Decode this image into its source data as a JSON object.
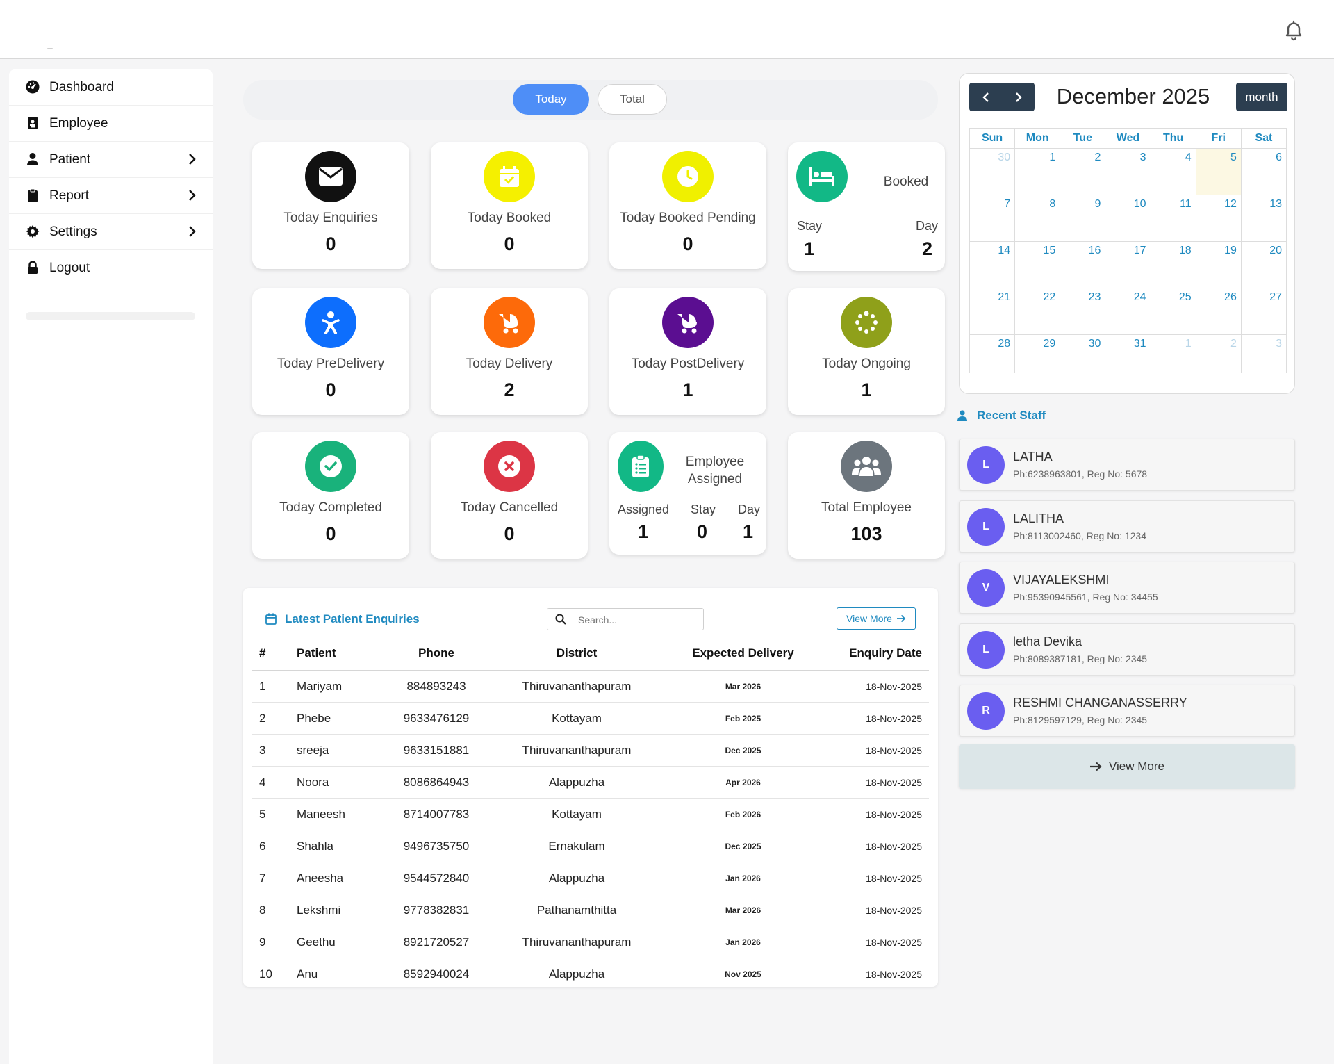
{
  "header": {
    "notification_icon": "bell-icon"
  },
  "sidebar": {
    "items": [
      {
        "label": "Dashboard",
        "icon": "dashboard-icon",
        "has_submenu": false
      },
      {
        "label": "Employee",
        "icon": "id-card-icon",
        "has_submenu": false
      },
      {
        "label": "Patient",
        "icon": "user-icon",
        "has_submenu": true
      },
      {
        "label": "Report",
        "icon": "clipboard-icon",
        "has_submenu": true
      },
      {
        "label": "Settings",
        "icon": "gear-icon",
        "has_submenu": true
      },
      {
        "label": "Logout",
        "icon": "lock-icon",
        "has_submenu": false
      }
    ]
  },
  "toggle": {
    "today": "Today",
    "total": "Total",
    "active": "Today"
  },
  "cards": {
    "enquiries": {
      "title": "Today Enquiries",
      "value": "0",
      "color": "#111111"
    },
    "booked": {
      "title": "Today Booked",
      "value": "0",
      "color": "#f5f000"
    },
    "booked_pending": {
      "title": "Today Booked Pending",
      "value": "0",
      "color": "#f0f000"
    },
    "booked_split": {
      "title": "Booked",
      "stay_label": "Stay",
      "stay_value": "1",
      "day_label": "Day",
      "day_value": "2",
      "color": "#12b886"
    },
    "predelivery": {
      "title": "Today PreDelivery",
      "value": "0",
      "color": "#0d6efd"
    },
    "delivery": {
      "title": "Today Delivery",
      "value": "2",
      "color": "#fd6a0a"
    },
    "postdelivery": {
      "title": "Today PostDelivery",
      "value": "1",
      "color": "#5b0e91"
    },
    "ongoing": {
      "title": "Today Ongoing",
      "value": "1",
      "color": "#8fa01a"
    },
    "completed": {
      "title": "Today Completed",
      "value": "0",
      "color": "#19b27b"
    },
    "cancelled": {
      "title": "Today Cancelled",
      "value": "0",
      "color": "#dc3545"
    },
    "employee_assigned": {
      "title": "Employee Assigned",
      "assigned_label": "Assigned",
      "assigned_value": "1",
      "stay_label": "Stay",
      "stay_value": "0",
      "day_label": "Day",
      "day_value": "1",
      "color": "#12b886"
    },
    "total_employee": {
      "title": "Total Employee",
      "value": "103",
      "color": "#6c757d"
    }
  },
  "enquiries": {
    "title": "Latest Patient Enquiries",
    "search_placeholder": "Search...",
    "view_more": "View More",
    "columns": [
      "#",
      "Patient",
      "Phone",
      "District",
      "Expected Delivery",
      "Enquiry Date"
    ],
    "rows": [
      [
        "1",
        "Mariyam",
        "884893243",
        "Thiruvananthapuram",
        "Mar 2026",
        "18-Nov-2025"
      ],
      [
        "2",
        "Phebe",
        "9633476129",
        "Kottayam",
        "Feb 2025",
        "18-Nov-2025"
      ],
      [
        "3",
        "sreeja",
        "9633151881",
        "Thiruvananthapuram",
        "Dec 2025",
        "18-Nov-2025"
      ],
      [
        "4",
        "Noora",
        "8086864943",
        "Alappuzha",
        "Apr 2026",
        "18-Nov-2025"
      ],
      [
        "5",
        "Maneesh",
        "8714007783",
        "Kottayam",
        "Feb 2026",
        "18-Nov-2025"
      ],
      [
        "6",
        "Shahla",
        "9496735750",
        "Ernakulam",
        "Dec 2025",
        "18-Nov-2025"
      ],
      [
        "7",
        "Aneesha",
        "9544572840",
        "Alappuzha",
        "Jan 2026",
        "18-Nov-2025"
      ],
      [
        "8",
        "Lekshmi",
        "9778382831",
        "Pathanamthitta",
        "Mar 2026",
        "18-Nov-2025"
      ],
      [
        "9",
        "Geethu",
        "8921720527",
        "Thiruvananthapuram",
        "Jan 2026",
        "18-Nov-2025"
      ],
      [
        "10",
        "Anu",
        "8592940024",
        "Alappuzha",
        "Nov 2025",
        "18-Nov-2025"
      ]
    ]
  },
  "calendar": {
    "title": "December 2025",
    "view_button": "month",
    "weekdays": [
      "Sun",
      "Mon",
      "Tue",
      "Wed",
      "Thu",
      "Fri",
      "Sat"
    ],
    "weeks": [
      [
        "30",
        "1",
        "2",
        "3",
        "4",
        "5",
        "6"
      ],
      [
        "7",
        "8",
        "9",
        "10",
        "11",
        "12",
        "13"
      ],
      [
        "14",
        "15",
        "16",
        "17",
        "18",
        "19",
        "20"
      ],
      [
        "21",
        "22",
        "23",
        "24",
        "25",
        "26",
        "27"
      ],
      [
        "28",
        "29",
        "30",
        "31",
        "1",
        "2",
        "3"
      ]
    ],
    "other_month": [
      [
        0,
        0
      ],
      [
        4,
        4
      ],
      [
        4,
        5
      ],
      [
        4,
        6
      ]
    ],
    "today": [
      0,
      5
    ]
  },
  "recent_staff": {
    "title": "Recent Staff",
    "avatar_color": "#6a5ef0",
    "items": [
      {
        "initial": "L",
        "name": "LATHA",
        "detail": "Ph:6238963801, Reg No: 5678"
      },
      {
        "initial": "L",
        "name": "LALITHA",
        "detail": "Ph:8113002460, Reg No: 1234"
      },
      {
        "initial": "V",
        "name": "VIJAYALEKSHMI",
        "detail": "Ph:95390945561, Reg No: 34455"
      },
      {
        "initial": "L",
        "name": "letha Devika",
        "detail": "Ph:8089387181, Reg No: 2345"
      },
      {
        "initial": "R",
        "name": "RESHMI CHANGANASSERRY",
        "detail": "Ph:8129597129, Reg No: 2345"
      }
    ],
    "view_more": "View More"
  }
}
